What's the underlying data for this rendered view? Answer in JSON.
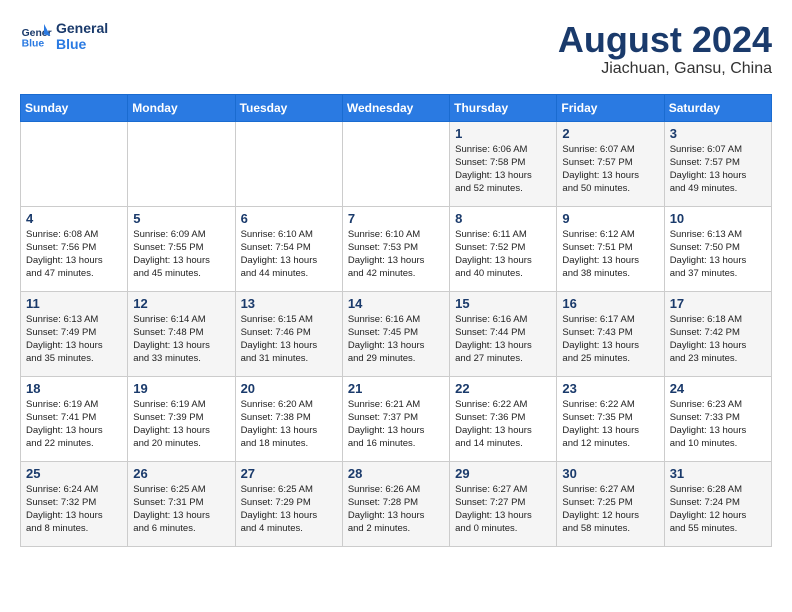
{
  "header": {
    "logo_general": "General",
    "logo_blue": "Blue",
    "month_year": "August 2024",
    "location": "Jiachuan, Gansu, China"
  },
  "days_of_week": [
    "Sunday",
    "Monday",
    "Tuesday",
    "Wednesday",
    "Thursday",
    "Friday",
    "Saturday"
  ],
  "weeks": [
    [
      {
        "day": "",
        "info": ""
      },
      {
        "day": "",
        "info": ""
      },
      {
        "day": "",
        "info": ""
      },
      {
        "day": "",
        "info": ""
      },
      {
        "day": "1",
        "info": "Sunrise: 6:06 AM\nSunset: 7:58 PM\nDaylight: 13 hours\nand 52 minutes."
      },
      {
        "day": "2",
        "info": "Sunrise: 6:07 AM\nSunset: 7:57 PM\nDaylight: 13 hours\nand 50 minutes."
      },
      {
        "day": "3",
        "info": "Sunrise: 6:07 AM\nSunset: 7:57 PM\nDaylight: 13 hours\nand 49 minutes."
      }
    ],
    [
      {
        "day": "4",
        "info": "Sunrise: 6:08 AM\nSunset: 7:56 PM\nDaylight: 13 hours\nand 47 minutes."
      },
      {
        "day": "5",
        "info": "Sunrise: 6:09 AM\nSunset: 7:55 PM\nDaylight: 13 hours\nand 45 minutes."
      },
      {
        "day": "6",
        "info": "Sunrise: 6:10 AM\nSunset: 7:54 PM\nDaylight: 13 hours\nand 44 minutes."
      },
      {
        "day": "7",
        "info": "Sunrise: 6:10 AM\nSunset: 7:53 PM\nDaylight: 13 hours\nand 42 minutes."
      },
      {
        "day": "8",
        "info": "Sunrise: 6:11 AM\nSunset: 7:52 PM\nDaylight: 13 hours\nand 40 minutes."
      },
      {
        "day": "9",
        "info": "Sunrise: 6:12 AM\nSunset: 7:51 PM\nDaylight: 13 hours\nand 38 minutes."
      },
      {
        "day": "10",
        "info": "Sunrise: 6:13 AM\nSunset: 7:50 PM\nDaylight: 13 hours\nand 37 minutes."
      }
    ],
    [
      {
        "day": "11",
        "info": "Sunrise: 6:13 AM\nSunset: 7:49 PM\nDaylight: 13 hours\nand 35 minutes."
      },
      {
        "day": "12",
        "info": "Sunrise: 6:14 AM\nSunset: 7:48 PM\nDaylight: 13 hours\nand 33 minutes."
      },
      {
        "day": "13",
        "info": "Sunrise: 6:15 AM\nSunset: 7:46 PM\nDaylight: 13 hours\nand 31 minutes."
      },
      {
        "day": "14",
        "info": "Sunrise: 6:16 AM\nSunset: 7:45 PM\nDaylight: 13 hours\nand 29 minutes."
      },
      {
        "day": "15",
        "info": "Sunrise: 6:16 AM\nSunset: 7:44 PM\nDaylight: 13 hours\nand 27 minutes."
      },
      {
        "day": "16",
        "info": "Sunrise: 6:17 AM\nSunset: 7:43 PM\nDaylight: 13 hours\nand 25 minutes."
      },
      {
        "day": "17",
        "info": "Sunrise: 6:18 AM\nSunset: 7:42 PM\nDaylight: 13 hours\nand 23 minutes."
      }
    ],
    [
      {
        "day": "18",
        "info": "Sunrise: 6:19 AM\nSunset: 7:41 PM\nDaylight: 13 hours\nand 22 minutes."
      },
      {
        "day": "19",
        "info": "Sunrise: 6:19 AM\nSunset: 7:39 PM\nDaylight: 13 hours\nand 20 minutes."
      },
      {
        "day": "20",
        "info": "Sunrise: 6:20 AM\nSunset: 7:38 PM\nDaylight: 13 hours\nand 18 minutes."
      },
      {
        "day": "21",
        "info": "Sunrise: 6:21 AM\nSunset: 7:37 PM\nDaylight: 13 hours\nand 16 minutes."
      },
      {
        "day": "22",
        "info": "Sunrise: 6:22 AM\nSunset: 7:36 PM\nDaylight: 13 hours\nand 14 minutes."
      },
      {
        "day": "23",
        "info": "Sunrise: 6:22 AM\nSunset: 7:35 PM\nDaylight: 13 hours\nand 12 minutes."
      },
      {
        "day": "24",
        "info": "Sunrise: 6:23 AM\nSunset: 7:33 PM\nDaylight: 13 hours\nand 10 minutes."
      }
    ],
    [
      {
        "day": "25",
        "info": "Sunrise: 6:24 AM\nSunset: 7:32 PM\nDaylight: 13 hours\nand 8 minutes."
      },
      {
        "day": "26",
        "info": "Sunrise: 6:25 AM\nSunset: 7:31 PM\nDaylight: 13 hours\nand 6 minutes."
      },
      {
        "day": "27",
        "info": "Sunrise: 6:25 AM\nSunset: 7:29 PM\nDaylight: 13 hours\nand 4 minutes."
      },
      {
        "day": "28",
        "info": "Sunrise: 6:26 AM\nSunset: 7:28 PM\nDaylight: 13 hours\nand 2 minutes."
      },
      {
        "day": "29",
        "info": "Sunrise: 6:27 AM\nSunset: 7:27 PM\nDaylight: 13 hours\nand 0 minutes."
      },
      {
        "day": "30",
        "info": "Sunrise: 6:27 AM\nSunset: 7:25 PM\nDaylight: 12 hours\nand 58 minutes."
      },
      {
        "day": "31",
        "info": "Sunrise: 6:28 AM\nSunset: 7:24 PM\nDaylight: 12 hours\nand 55 minutes."
      }
    ]
  ]
}
